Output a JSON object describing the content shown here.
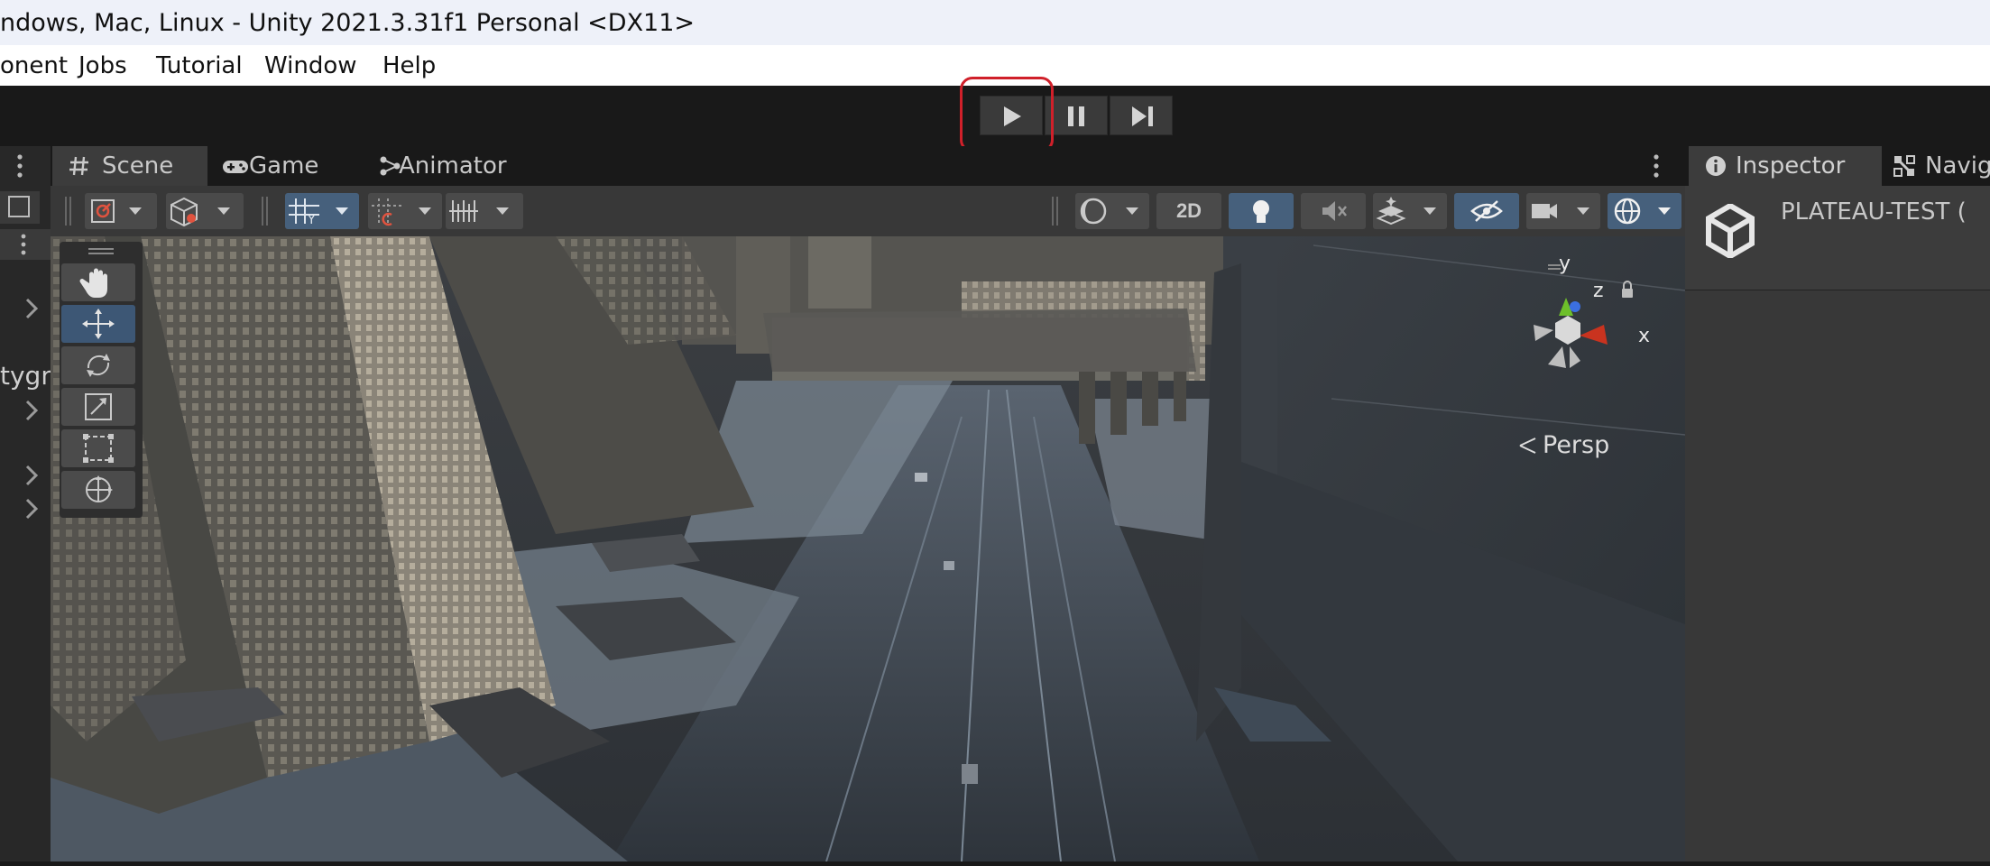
{
  "window": {
    "title": "ndows, Mac, Linux - Unity 2021.3.31f1 Personal <DX11>"
  },
  "menu": [
    "onent",
    "Jobs",
    "Tutorial",
    "Window",
    "Help"
  ],
  "playbar": {
    "play_icon": "play-icon",
    "pause_icon": "pause-icon",
    "step_icon": "step-icon",
    "highlight_color": "#d0202a"
  },
  "left_panel": {
    "truncated_item": "tygm"
  },
  "tabs": {
    "scene": "Scene",
    "game": "Game",
    "animator": "Animator"
  },
  "scene_toolbar": {
    "mode_2d": "2D"
  },
  "gizmo": {
    "x": "x",
    "y": "y",
    "z": "z",
    "projection": "Persp",
    "x_color": "#c9331f",
    "y_color": "#6dbf2a",
    "z_color": "#3b6fe0"
  },
  "inspector": {
    "tab_label": "Inspector",
    "nav_tab_label": "Navig",
    "object_name": "PLATEAU-TEST ("
  },
  "colors": {
    "titlebar": "#eef1f9",
    "editor_bg": "#191919",
    "panel": "#383838",
    "active_tool": "#46607c"
  }
}
